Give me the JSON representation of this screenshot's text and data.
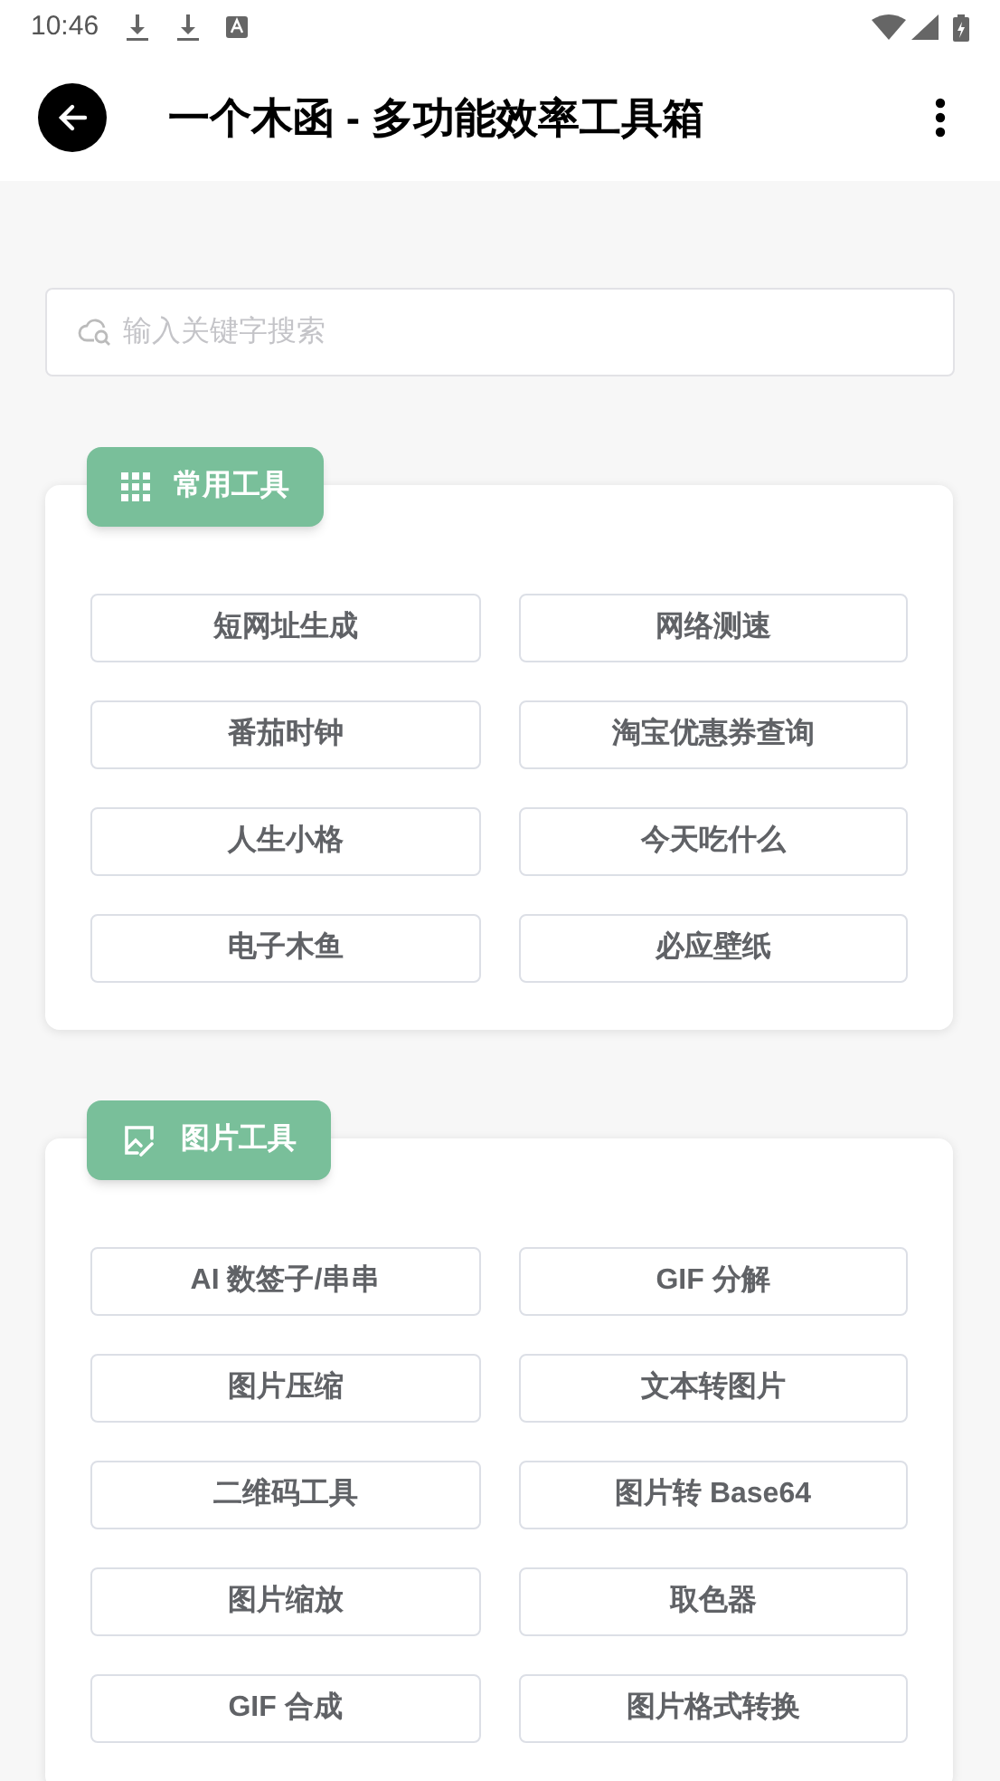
{
  "status_bar": {
    "time": "10:46"
  },
  "app_bar": {
    "title": "一个木函 - 多功能效率工具箱"
  },
  "search": {
    "placeholder": "输入关键字搜索"
  },
  "sections": [
    {
      "kind": "grid",
      "title": "常用工具",
      "tools": [
        "短网址生成",
        "网络测速",
        "番茄时钟",
        "淘宝优惠券查询",
        "人生小格",
        "今天吃什么",
        "电子木鱼",
        "必应壁纸"
      ]
    },
    {
      "kind": "image",
      "title": "图片工具",
      "tools": [
        "AI 数签子/串串",
        "GIF 分解",
        "图片压缩",
        "文本转图片",
        "二维码工具",
        "图片转 Base64",
        "图片缩放",
        "取色器",
        "GIF 合成",
        "图片格式转换"
      ]
    }
  ]
}
